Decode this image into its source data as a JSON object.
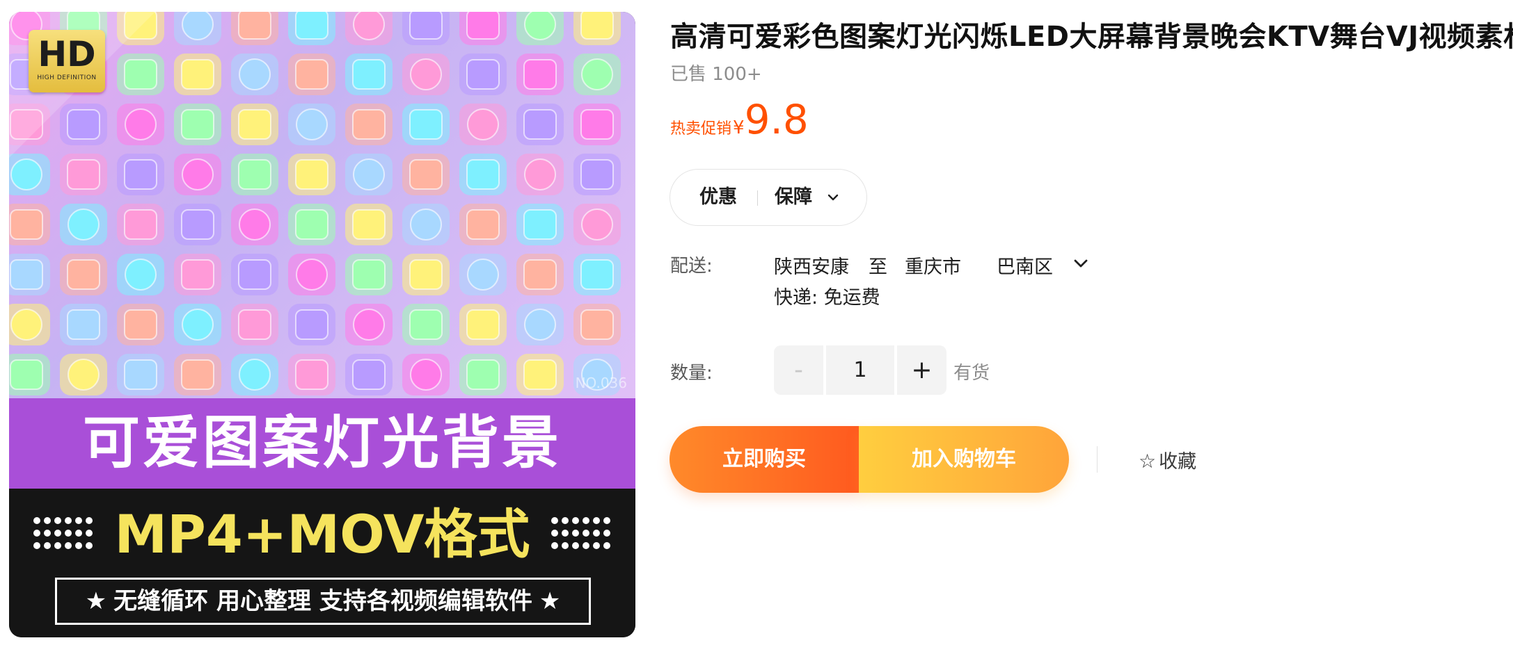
{
  "product_image": {
    "badge_text": "HD",
    "badge_subtext": "HIGH DEFINITION",
    "watermark": "NO.036",
    "banner_title": "可爱图案灯光背景",
    "format_text": "MP4+MOV格式",
    "tagline": "无缝循环 用心整理 支持各视频编辑软件",
    "star_glyph": "★"
  },
  "product": {
    "title": "高清可爱彩色图案灯光闪烁LED大屏幕背景晚会KTV舞台VJ视频素材",
    "sold": "已售 100+",
    "promo_label": "热卖促销",
    "currency": "¥",
    "price": "9.8"
  },
  "tabs": {
    "discount_label": "优惠",
    "guarantee_label": "保障"
  },
  "shipping": {
    "label": "配送:",
    "from": "陕西安康",
    "to": "至",
    "city": "重庆市",
    "district": "巴南区",
    "express": "快递: 免运费"
  },
  "quantity": {
    "label": "数量:",
    "minus": "-",
    "value": "1",
    "plus": "+",
    "stock": "有货"
  },
  "actions": {
    "buy_now": "立即购买",
    "add_to_cart": "加入购物车",
    "favorite": "收藏",
    "favorite_icon": "☆"
  },
  "colors": {
    "price_orange": "#ff5000",
    "buy_now": "#ff6a22",
    "add_to_cart": "#ffb83b",
    "banner_purple": "#a94fd8",
    "format_yellow": "#f5e35d"
  }
}
